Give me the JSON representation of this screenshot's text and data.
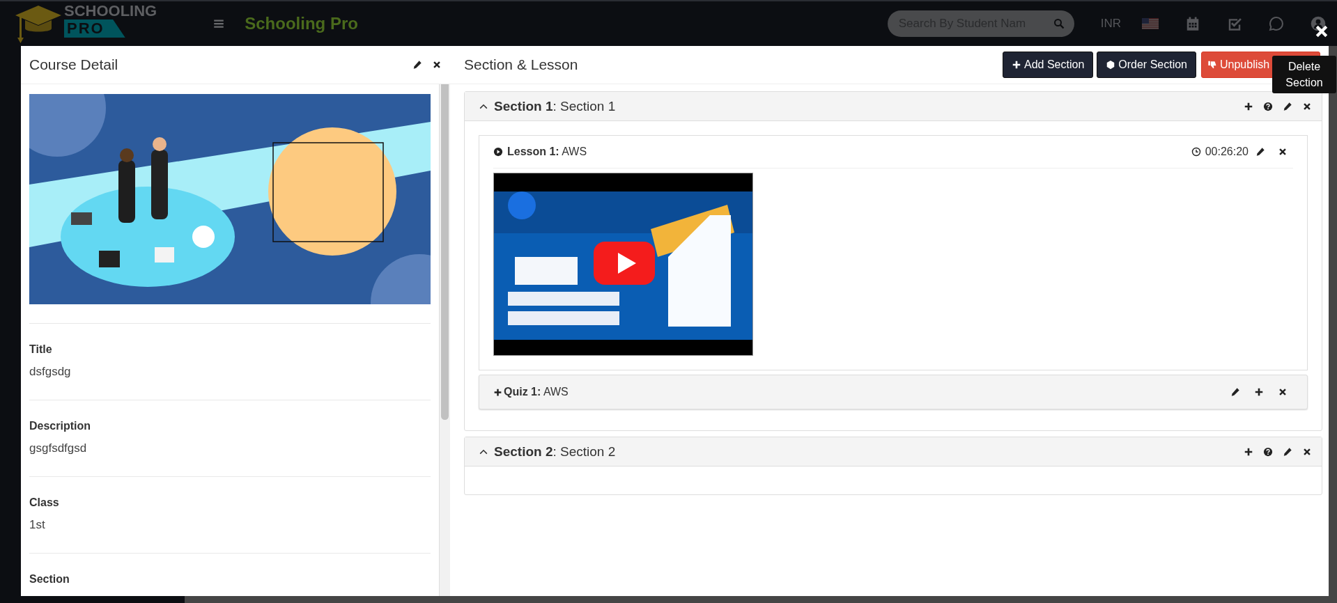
{
  "topbar": {
    "logo_top": "SCHOOLING",
    "logo_bottom": "PRO",
    "app_title": "Schooling Pro",
    "search": {
      "placeholder": "Search By Student Nam"
    },
    "currency": "INR"
  },
  "course_detail": {
    "title": "Course Detail",
    "fields": [
      {
        "label": "Title",
        "value": "dsfgsdg"
      },
      {
        "label": "Description",
        "value": "gsgfsdfgsd"
      },
      {
        "label": "Class",
        "value": "1st"
      },
      {
        "label": "Section"
      }
    ]
  },
  "section_lesson": {
    "title": "Section & Lesson",
    "buttons": [
      {
        "label": "Add Section",
        "kind": "add"
      },
      {
        "label": "Order Section",
        "kind": "order"
      },
      {
        "label": "Unpublish",
        "kind": "unpublish"
      }
    ],
    "tooltip": "Delete Section",
    "sections": [
      {
        "title": "**Section 1**: Section 1",
        "expanded": true,
        "items": [
          {
            "kind": "lesson",
            "title": "**Lesson 1:** AWS",
            "duration": "00:26:20"
          },
          {
            "kind": "quiz",
            "title": "**Quiz 1:** AWS"
          }
        ]
      },
      {
        "title": "**Section 2**: Section 2",
        "expanded": true
      }
    ]
  }
}
